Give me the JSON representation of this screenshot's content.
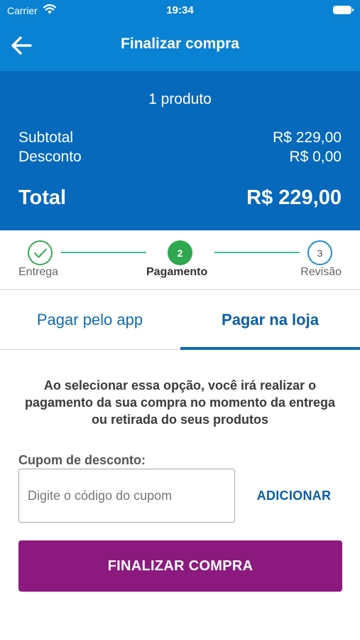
{
  "status_bar": {
    "carrier": "Carrier",
    "time": "19:34",
    "icons": [
      "wifi-icon",
      "battery-icon"
    ]
  },
  "header": {
    "title": "Finalizar compra",
    "back_icon": "arrow-left-icon"
  },
  "summary": {
    "product_count": "1 produto",
    "subtotal_label": "Subtotal",
    "subtotal_value": "R$ 229,00",
    "discount_label": "Desconto",
    "discount_value": "R$ 0,00",
    "total_label": "Total",
    "total_value": "R$ 229,00"
  },
  "stepper": {
    "steps": [
      {
        "label": "Entrega",
        "state": "done",
        "icon": "checkmark-icon"
      },
      {
        "label": "Pagamento",
        "number": "2",
        "state": "current"
      },
      {
        "label": "Revisão",
        "number": "3",
        "state": "upcoming"
      }
    ]
  },
  "tabs": {
    "items": [
      {
        "label": "Pagar pelo app",
        "active": false
      },
      {
        "label": "Pagar na loja",
        "active": true
      }
    ]
  },
  "info_text": "Ao selecionar essa opção, você irá realizar o pagamento da sua compra no momento da entrega ou retirada do seus produtos",
  "coupon": {
    "label": "Cupom de desconto:",
    "placeholder": "Digite o código do cupom",
    "value": "",
    "add_label": "ADICIONAR"
  },
  "finalize_label": "FINALIZAR COMPRA",
  "colors": {
    "header_blue": "#0a82d3",
    "summary_blue": "#0669bb",
    "step_green": "#2fa84f",
    "accent_blue": "#0b5ea8",
    "finalize_purple": "#8c1a7e"
  }
}
